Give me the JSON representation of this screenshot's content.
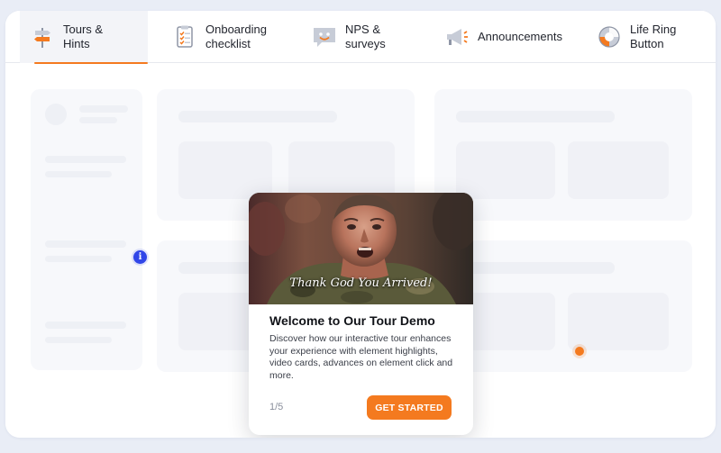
{
  "tabs": [
    {
      "label_line1": "Tours &",
      "label_line2": "Hints",
      "icon": "signpost-icon",
      "active": true
    },
    {
      "label_line1": "Onboarding",
      "label_line2": "checklist",
      "icon": "checklist-icon",
      "active": false
    },
    {
      "label_line1": "NPS &",
      "label_line2": "surveys",
      "icon": "survey-chat-icon",
      "active": false
    },
    {
      "label_line1": "Announcements",
      "label_line2": "",
      "icon": "megaphone-icon",
      "active": false
    },
    {
      "label_line1": "Life Ring",
      "label_line2": "Button",
      "icon": "life-ring-icon",
      "active": false
    }
  ],
  "colors": {
    "accent": "#f47a1f",
    "info": "#3146e8",
    "background": "#e9edf6"
  },
  "tour_card": {
    "image_caption": "Thank God You Arrived!",
    "title": "Welcome to Our Tour Demo",
    "description": "Discover how our interactive tour enhances your experience with element highlights, video cards, advances on element click and more.",
    "step": "1/5",
    "cta_label": "GET STARTED"
  },
  "hotspots": {
    "info_glyph": "i"
  }
}
